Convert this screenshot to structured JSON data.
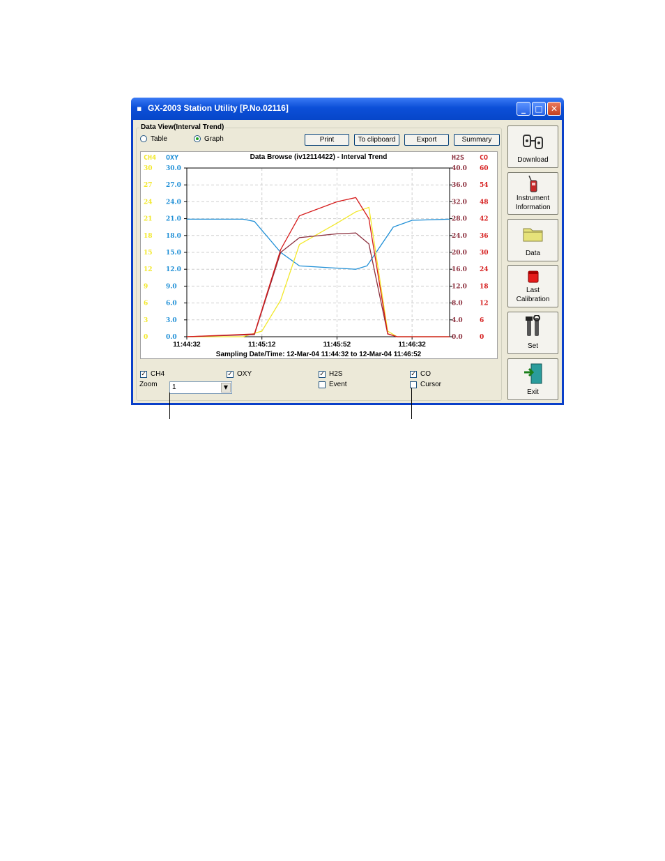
{
  "window": {
    "title": "GX-2003 Station Utility [P.No.02116]"
  },
  "group": {
    "label": "Data View(Interval Trend)"
  },
  "view_mode": {
    "table_label": "Table",
    "graph_label": "Graph",
    "selected": "Graph"
  },
  "toolbar": {
    "print": "Print",
    "clipboard": "To clipboard",
    "export": "Export",
    "summary": "Summary"
  },
  "chart_data": {
    "type": "line",
    "title": "Data Browse (iv12114422) - Interval Trend",
    "xlabel": "Sampling Date/Time: 12-Mar-04 11:44:32 to 12-Mar-04 11:46:52",
    "x_ticks": [
      "11:44:32",
      "11:45:12",
      "11:45:52",
      "11:46:32"
    ],
    "axes": [
      {
        "name": "CH4",
        "color": "#f2e82a",
        "side": "left",
        "ticks": [
          "0",
          "3",
          "6",
          "9",
          "12",
          "15",
          "18",
          "21",
          "24",
          "27",
          "30"
        ]
      },
      {
        "name": "OXY",
        "color": "#1f8fd6",
        "side": "left",
        "ticks": [
          "0.0",
          "3.0",
          "6.0",
          "9.0",
          "12.0",
          "15.0",
          "18.0",
          "21.0",
          "24.0",
          "27.0",
          "30.0"
        ]
      },
      {
        "name": "H2S",
        "color": "#8b2e3c",
        "side": "right",
        "ticks": [
          "0.0",
          "4.0",
          "8.0",
          "12.0",
          "16.0",
          "20.0",
          "24.0",
          "28.0",
          "32.0",
          "36.0",
          "40.0"
        ]
      },
      {
        "name": "CO",
        "color": "#d51a1a",
        "side": "right",
        "ticks": [
          "0",
          "6",
          "12",
          "18",
          "24",
          "30",
          "36",
          "42",
          "48",
          "54",
          "60"
        ]
      }
    ],
    "x_seconds_from": "11:44:32",
    "series": [
      {
        "name": "OXY",
        "color": "#1f8fd6",
        "axis_max": 30,
        "points": [
          [
            0,
            20.9
          ],
          [
            30,
            20.9
          ],
          [
            36,
            20.5
          ],
          [
            50,
            15
          ],
          [
            60,
            12.6
          ],
          [
            80,
            12.2
          ],
          [
            90,
            12
          ],
          [
            96,
            12.6
          ],
          [
            110,
            19.5
          ],
          [
            120,
            20.7
          ],
          [
            140,
            20.9
          ]
        ]
      },
      {
        "name": "CH4",
        "color": "#f2e82a",
        "axis_max": 30,
        "points": [
          [
            0,
            0
          ],
          [
            30,
            0
          ],
          [
            40,
            1
          ],
          [
            50,
            6.5
          ],
          [
            60,
            16.4
          ],
          [
            80,
            20.2
          ],
          [
            90,
            22.2
          ],
          [
            97,
            23
          ],
          [
            107,
            1
          ],
          [
            112,
            0
          ],
          [
            140,
            0
          ]
        ]
      },
      {
        "name": "H2S",
        "color": "#8b2e3c",
        "axis_max": 40,
        "points": [
          [
            0,
            0
          ],
          [
            36,
            0.5
          ],
          [
            50,
            20
          ],
          [
            60,
            23.5
          ],
          [
            80,
            24.4
          ],
          [
            90,
            24.6
          ],
          [
            97,
            22
          ],
          [
            107,
            0.7
          ],
          [
            112,
            0
          ],
          [
            140,
            0
          ]
        ]
      },
      {
        "name": "CO",
        "color": "#d51a1a",
        "axis_max": 60,
        "points": [
          [
            0,
            0
          ],
          [
            36,
            1
          ],
          [
            50,
            31
          ],
          [
            60,
            43
          ],
          [
            80,
            48
          ],
          [
            90,
            49.5
          ],
          [
            97,
            42
          ],
          [
            107,
            1
          ],
          [
            112,
            0
          ],
          [
            140,
            0
          ]
        ]
      }
    ],
    "x_range": [
      0,
      140
    ],
    "grid": true
  },
  "checks": {
    "ch4": {
      "label": "CH4",
      "checked": true
    },
    "oxy": {
      "label": "OXY",
      "checked": true
    },
    "h2s": {
      "label": "H2S",
      "checked": true
    },
    "co": {
      "label": "CO",
      "checked": true
    },
    "event": {
      "label": "Event",
      "checked": false
    },
    "cursor": {
      "label": "Cursor",
      "checked": false
    }
  },
  "zoom": {
    "label": "Zoom",
    "value": "1"
  },
  "sidebar": {
    "download": "Download",
    "instrument_1": "Instrument",
    "instrument_2": "Information",
    "data": "Data",
    "calibration_1": "Last",
    "calibration_2": "Calibration",
    "set": "Set",
    "exit": "Exit"
  }
}
